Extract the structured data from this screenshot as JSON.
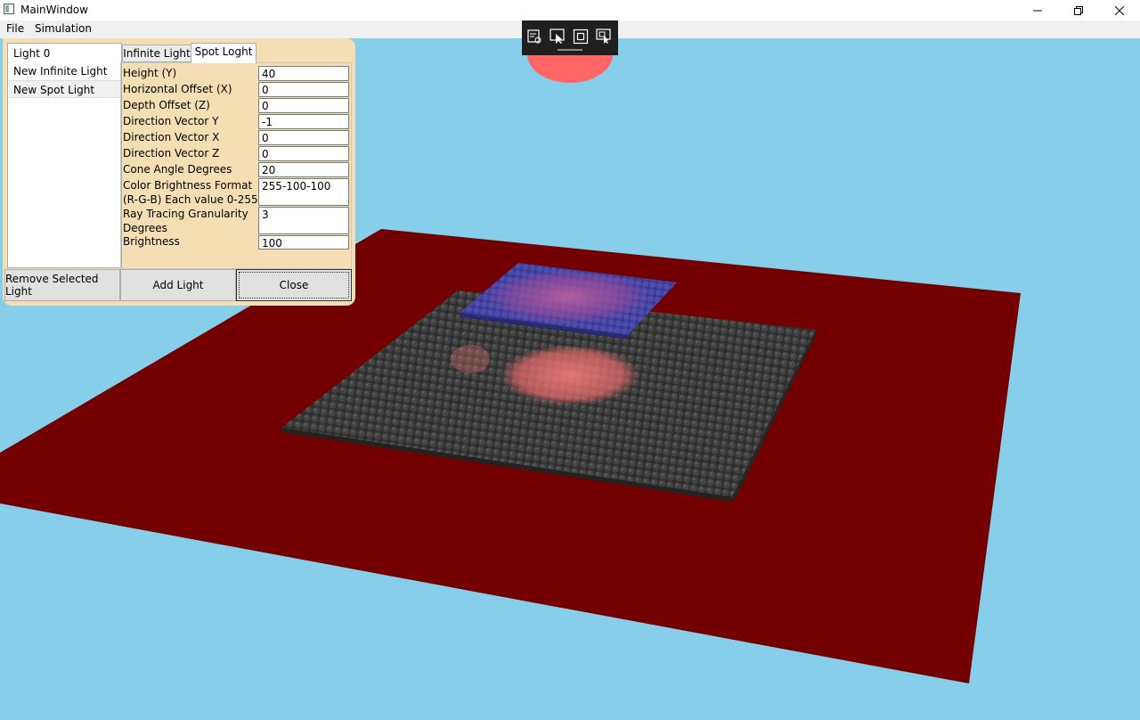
{
  "window": {
    "title": "MainWindow"
  },
  "menu": {
    "file": "File",
    "simulation": "Simulation"
  },
  "lights_panel": {
    "lights": [
      "Light 0",
      "New Infinite Light",
      "New Spot Light"
    ],
    "tabs": [
      "Infinite Light",
      "Spot Loght"
    ],
    "fields": [
      {
        "label": "Height (Y)",
        "value": "40"
      },
      {
        "label": "Horizontal Offset (X)",
        "value": "0"
      },
      {
        "label": "Depth Offset (Z)",
        "value": "0"
      },
      {
        "label": "Direction Vector Y",
        "value": "-1"
      },
      {
        "label": "Direction Vector X",
        "value": "0"
      },
      {
        "label": "Direction Vector Z",
        "value": "0"
      },
      {
        "label": "Cone Angle Degrees",
        "value": "20"
      },
      {
        "label": "Color Brightness Format (R-G-B) Each value 0-255",
        "value": "255-100-100"
      },
      {
        "label": "Ray Tracing Granularity Degrees",
        "value": "3"
      },
      {
        "label": "Brightness",
        "value": "100"
      }
    ],
    "buttons": {
      "remove": "Remove Selected Light",
      "add": "Add Light",
      "close": "Close"
    }
  },
  "colors": {
    "sky": "#87ceeb",
    "floor": "#730000",
    "grid": "#3a3a3a",
    "spot": "#ff6666",
    "raised_block": "#3c3c9e",
    "panel": "#f5deb3"
  },
  "icons": [
    "window-app-icon",
    "minimize-icon",
    "restore-icon",
    "close-icon",
    "live-visual-tree-icon",
    "select-element-icon",
    "display-layout-adorners-icon",
    "track-focused-element-icon"
  ]
}
